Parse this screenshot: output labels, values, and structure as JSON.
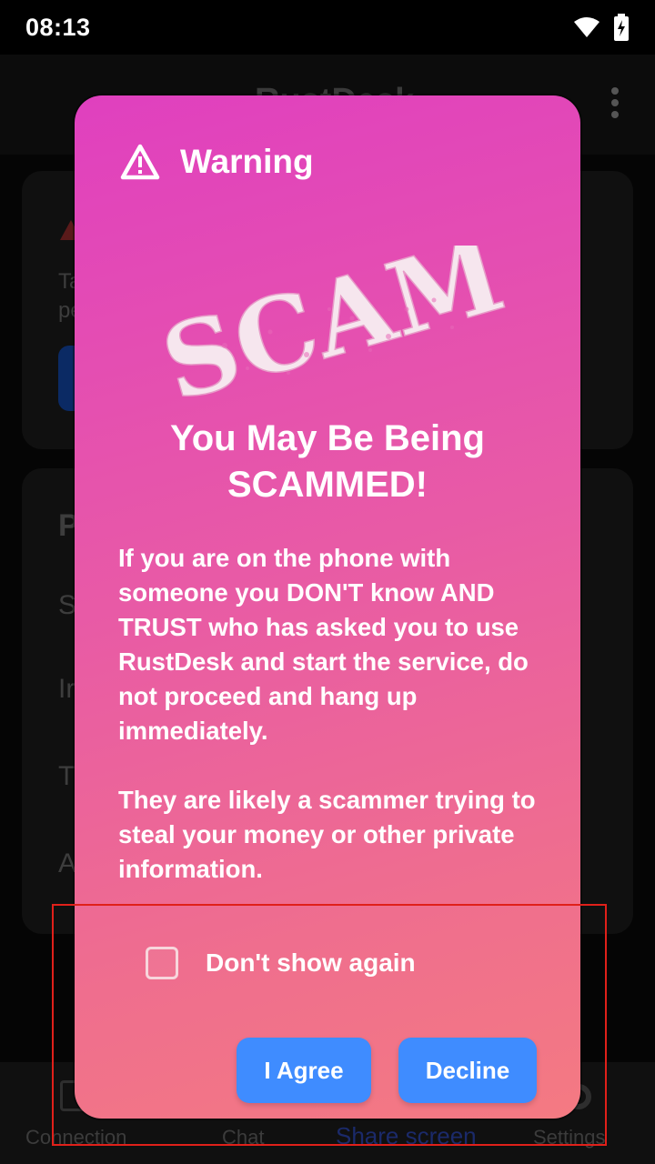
{
  "status_bar": {
    "time": "08:13"
  },
  "app": {
    "title": "RustDesk",
    "nav": [
      {
        "label": "Connection"
      },
      {
        "label": "Chat"
      },
      {
        "label": "Share screen"
      },
      {
        "label": "Settings"
      }
    ]
  },
  "dialog": {
    "title": "Warning",
    "stamp": "SCAM",
    "headline_line1": "You May Be Being",
    "headline_line2": "SCAMMED!",
    "paragraph1": "If you are on the phone with someone you DON'T know AND TRUST who has asked you to use RustDesk and start the service, do not proceed and hang up immediately.",
    "paragraph2": "They are likely a scammer trying to steal your money or other private information.",
    "checkbox_label": "Don't show again",
    "checkbox_checked": false,
    "agree_label": "I Agree",
    "decline_label": "Decline"
  },
  "colors": {
    "gradient_top": "#e040bf",
    "gradient_bottom": "#f47a82",
    "button": "#3f8cff",
    "highlight": "#e0201a"
  }
}
